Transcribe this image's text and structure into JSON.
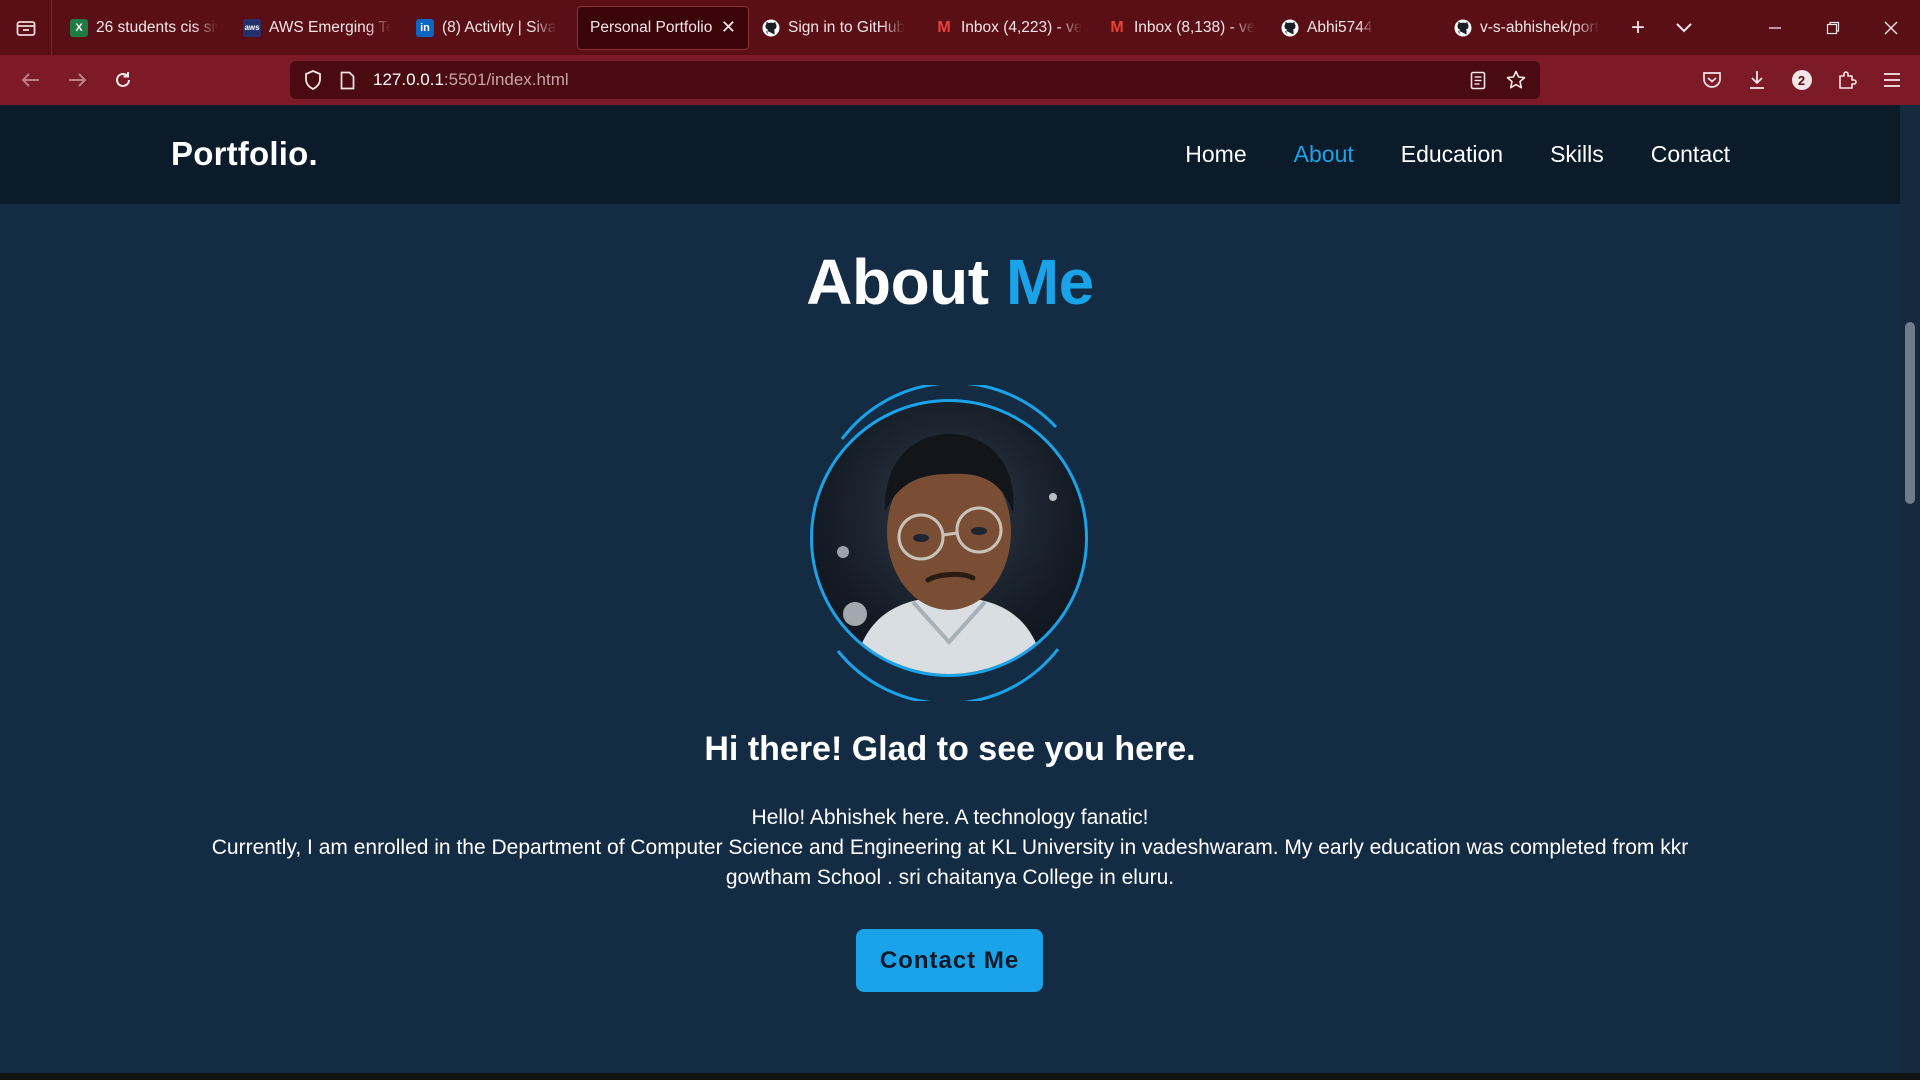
{
  "browser": {
    "tabs": [
      {
        "title": "26 students cis siv",
        "icon": "excel-icon",
        "color": "#1e7b45",
        "glyph": "X"
      },
      {
        "title": "AWS Emerging Te",
        "icon": "aws-icon",
        "color": "#26306b",
        "glyph": "aws"
      },
      {
        "title": "(8) Activity | Siva",
        "icon": "linkedin-icon",
        "color": "#0a66c2",
        "glyph": "in"
      },
      {
        "title": "Personal Portfolio",
        "icon": "",
        "color": "",
        "glyph": "",
        "active": true
      },
      {
        "title": "Sign in to GitHub",
        "icon": "github-icon",
        "color": "#ffffff",
        "glyph": ""
      },
      {
        "title": "Inbox (4,223) - ve",
        "icon": "gmail-icon",
        "color": "#ea4335",
        "glyph": "M"
      },
      {
        "title": "Inbox (8,138) - ve",
        "icon": "gmail-icon",
        "color": "#ea4335",
        "glyph": "M"
      },
      {
        "title": "Abhi5744",
        "icon": "github-icon",
        "color": "#ffffff",
        "glyph": ""
      },
      {
        "title": "v-s-abhishek/port",
        "icon": "github-icon",
        "color": "#ffffff",
        "glyph": ""
      }
    ],
    "url_host": "127.0.0.1",
    "url_rest": ":5501/index.html",
    "extensions_badge": "2",
    "theme_color": "#7c1b27"
  },
  "site": {
    "logo": "Portfolio.",
    "nav": [
      {
        "label": "Home"
      },
      {
        "label": "About",
        "active": true
      },
      {
        "label": "Education"
      },
      {
        "label": "Skills"
      },
      {
        "label": "Contact"
      }
    ],
    "title_main": "About",
    "title_accent": "Me",
    "greeting": "Hi there! Glad to see you here.",
    "bio_line1": "Hello! Abhishek here. A technology fanatic!",
    "bio_line2": "Currently, I am enrolled in the Department of Computer Science and Engineering at KL University in vadeshwaram. My early education was completed from kkr gowtham School . sri chaitanya College in eluru.",
    "cta_label": "Contact Me",
    "accent_color": "#1aa3e8",
    "bg_color": "#132c44",
    "header_color": "#0b1b2a"
  }
}
